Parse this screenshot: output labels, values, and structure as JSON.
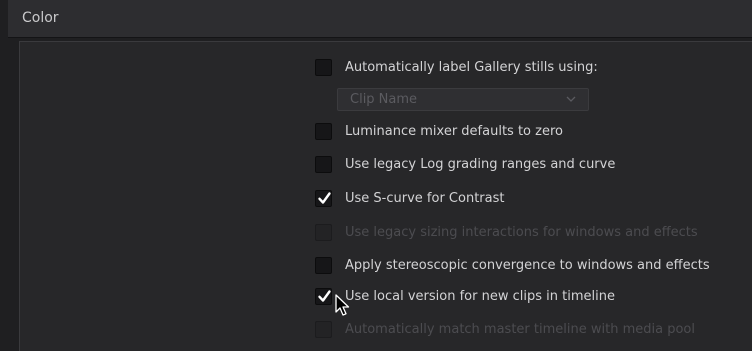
{
  "header": {
    "title": "Color"
  },
  "settings": [
    {
      "label": "Automatically label Gallery stills using:",
      "checked": false,
      "enabled": true
    },
    {
      "label": "Luminance mixer defaults to zero",
      "checked": false,
      "enabled": true
    },
    {
      "label": "Use legacy Log grading ranges and curve",
      "checked": false,
      "enabled": true
    },
    {
      "label": "Use S-curve for Contrast",
      "checked": true,
      "enabled": true
    },
    {
      "label": "Use legacy sizing interactions for windows and effects",
      "checked": false,
      "enabled": false
    },
    {
      "label": "Apply stereoscopic convergence to windows and effects",
      "checked": false,
      "enabled": true
    },
    {
      "label": "Use local version for new clips in timeline",
      "checked": true,
      "enabled": true
    },
    {
      "label": "Automatically match master timeline with media pool",
      "checked": false,
      "enabled": false
    }
  ],
  "gallery_label_dropdown": {
    "value": "Clip Name",
    "enabled": false
  },
  "icons": {
    "check": "checkmark-icon",
    "chevron": "chevron-down-icon",
    "cursor": "mouse-pointer-icon"
  },
  "colors": {
    "background": "#1f1f21",
    "header": "#2d2d30",
    "panel": "#272729",
    "text": "#d3d3d5",
    "text_disabled": "#4c4c50"
  }
}
